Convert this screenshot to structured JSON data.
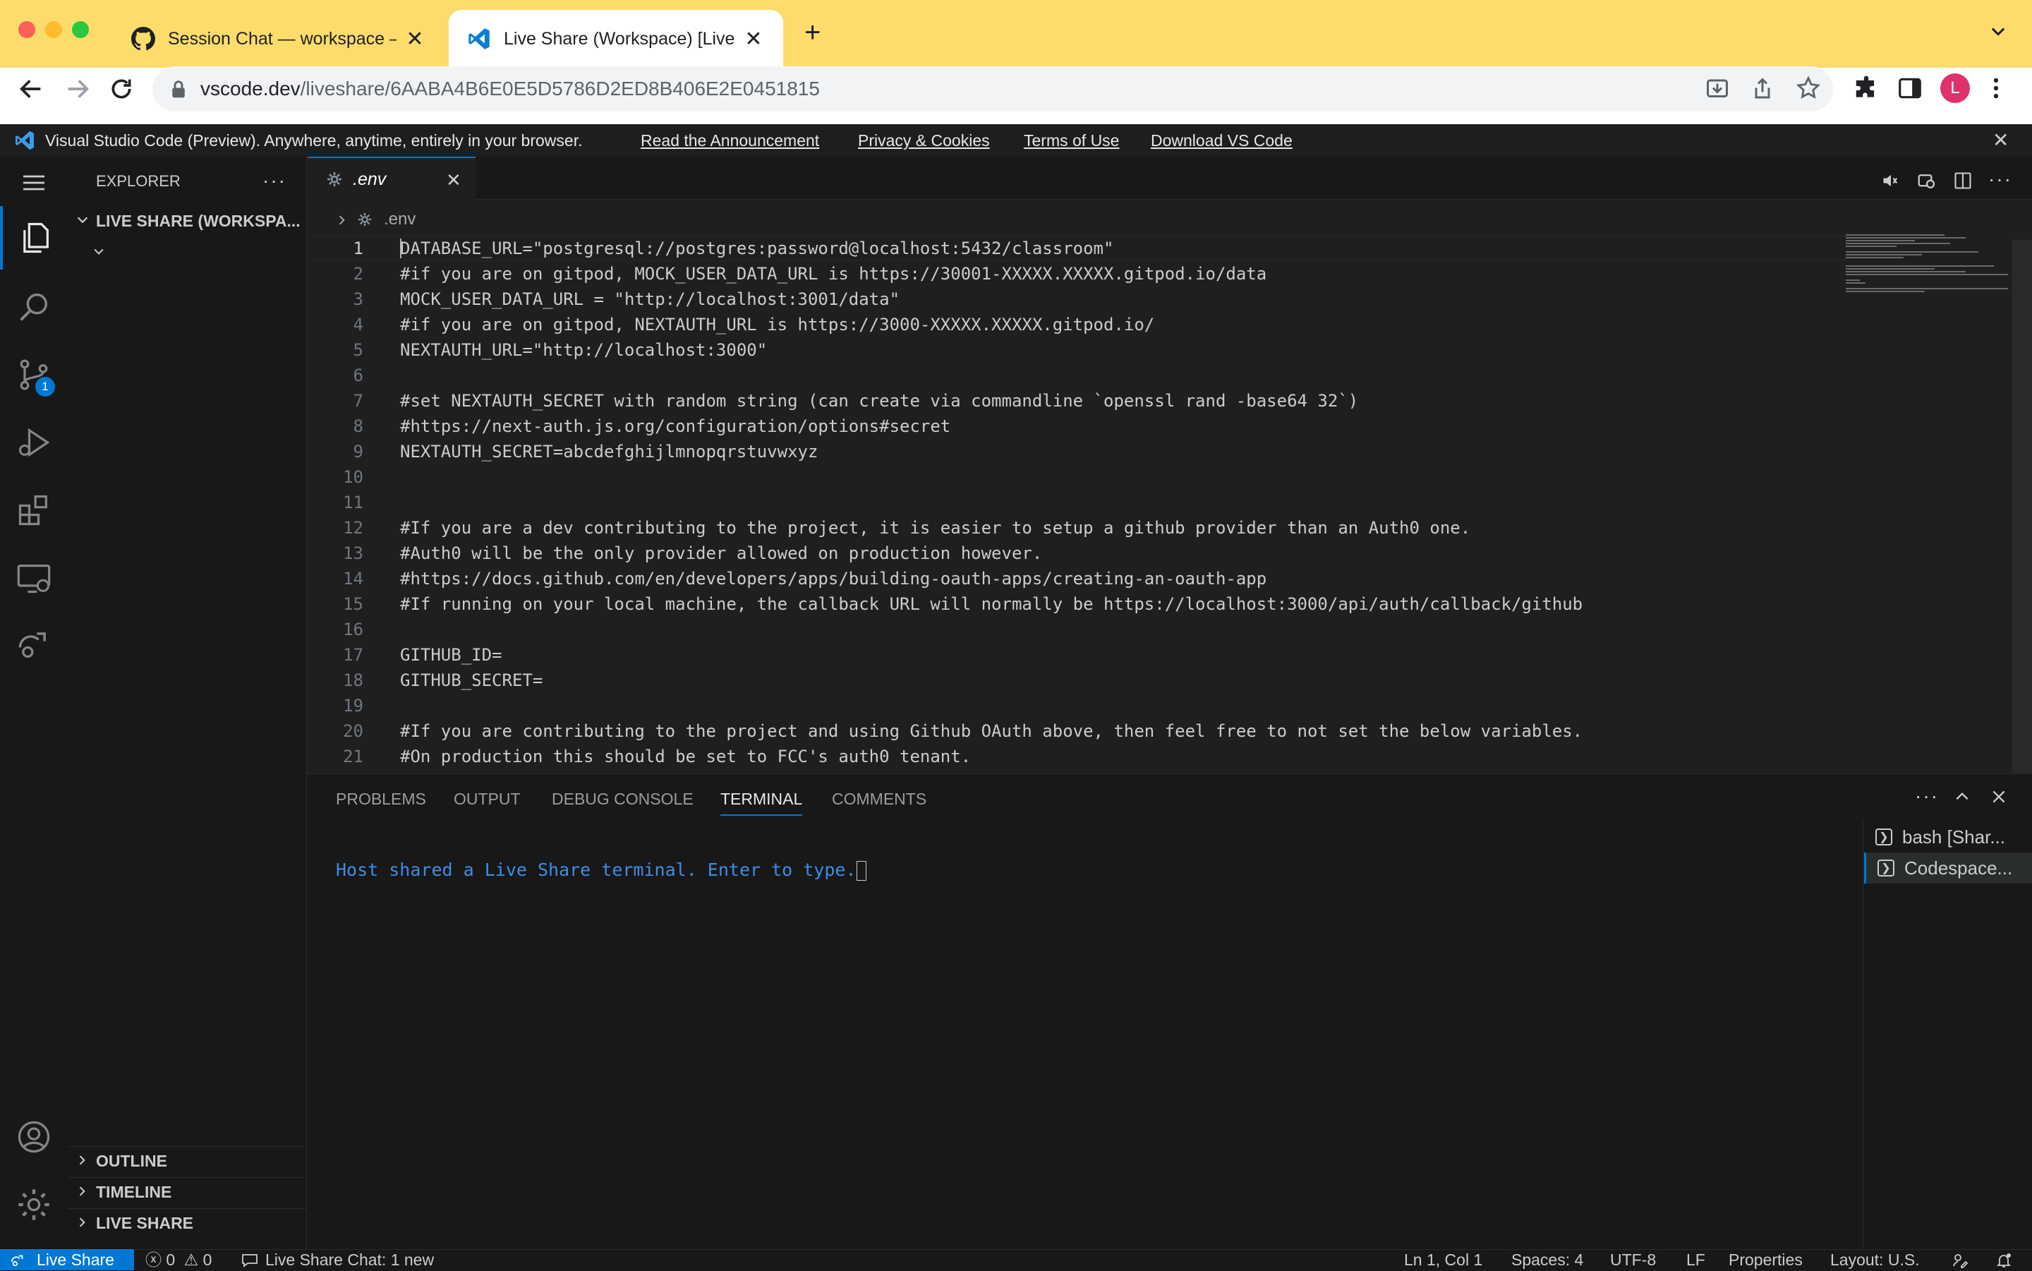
{
  "browser": {
    "tabs": [
      {
        "title": "Session Chat — workspace — ",
        "icon": "github-icon",
        "active": false
      },
      {
        "title": "Live Share (Workspace) [Live S",
        "icon": "vscode-icon",
        "active": true
      }
    ],
    "url_host": "vscode.dev",
    "url_path": "/liveshare/6AABA4B6E0E5D5786D2ED8B406E2E0451815",
    "profile_initial": "L",
    "profile_color": "#e0316e"
  },
  "banner": {
    "text": "Visual Studio Code (Preview). Anywhere, anytime, entirely in your browser.",
    "links": [
      "Read the Announcement",
      "Privacy & Cookies",
      "Terms of Use",
      "Download VS Code"
    ]
  },
  "activity_bar": {
    "icons": [
      "explorer-icon",
      "search-icon",
      "source-control-icon",
      "run-debug-icon",
      "extensions-icon",
      "remote-explorer-icon",
      "live-share-icon",
      "accounts-icon",
      "manage-gear-icon"
    ],
    "source_control_badge": "1"
  },
  "sidebar": {
    "title": "EXPLORER",
    "root_folder": "LIVE SHARE (WORKSPA...",
    "sections": [
      "OUTLINE",
      "TIMELINE",
      "LIVE SHARE"
    ]
  },
  "editor": {
    "tab_label": ".env",
    "breadcrumb": ".env",
    "lines": [
      {
        "n": "1",
        "text": "DATABASE_URL=\"postgresql://postgres:password@localhost:5432/classroom\""
      },
      {
        "n": "2",
        "text": "#if you are on gitpod, MOCK_USER_DATA_URL is https://30001-XXXXX.XXXXX.gitpod.io/data"
      },
      {
        "n": "3",
        "text": "MOCK_USER_DATA_URL = \"http://localhost:3001/data\""
      },
      {
        "n": "4",
        "text": "#if you are on gitpod, NEXTAUTH_URL is https://3000-XXXXX.XXXXX.gitpod.io/"
      },
      {
        "n": "5",
        "text": "NEXTAUTH_URL=\"http://localhost:3000\""
      },
      {
        "n": "6",
        "text": ""
      },
      {
        "n": "7",
        "text": "#set NEXTAUTH_SECRET with random string (can create via commandline `openssl rand -base64 32`)"
      },
      {
        "n": "8",
        "text": "#https://next-auth.js.org/configuration/options#secret"
      },
      {
        "n": "9",
        "text": "NEXTAUTH_SECRET=abcdefghijlmnopqrstuvwxyz"
      },
      {
        "n": "10",
        "text": ""
      },
      {
        "n": "11",
        "text": ""
      },
      {
        "n": "12",
        "text": "#If you are a dev contributing to the project, it is easier to setup a github provider than an Auth0 one."
      },
      {
        "n": "13",
        "text": "#Auth0 will be the only provider allowed on production however."
      },
      {
        "n": "14",
        "text": "#https://docs.github.com/en/developers/apps/building-oauth-apps/creating-an-oauth-app"
      },
      {
        "n": "15",
        "text": "#If running on your local machine, the callback URL will normally be https://localhost:3000/api/auth/callback/github"
      },
      {
        "n": "16",
        "text": ""
      },
      {
        "n": "17",
        "text": "GITHUB_ID="
      },
      {
        "n": "18",
        "text": "GITHUB_SECRET="
      },
      {
        "n": "19",
        "text": ""
      },
      {
        "n": "20",
        "text": "#If you are contributing to the project and using Github OAuth above, then feel free to not set the below variables."
      },
      {
        "n": "21",
        "text": "#On production this should be set to FCC's auth0 tenant."
      }
    ]
  },
  "panel": {
    "tabs": [
      "PROBLEMS",
      "OUTPUT",
      "DEBUG CONSOLE",
      "TERMINAL",
      "COMMENTS"
    ],
    "active_tab": "TERMINAL",
    "terminal_text": "Host shared a Live Share terminal. Enter to type.",
    "terminals": [
      "bash [Shar...",
      "Codespace..."
    ]
  },
  "status_bar": {
    "live_share": "Live Share",
    "errors": "0",
    "warnings": "0",
    "chat": "Live Share Chat: 1 new",
    "position": "Ln 1, Col 1",
    "spaces": "Spaces: 4",
    "encoding": "UTF-8",
    "eol": "LF",
    "language": "Properties",
    "layout": "Layout: U.S."
  }
}
